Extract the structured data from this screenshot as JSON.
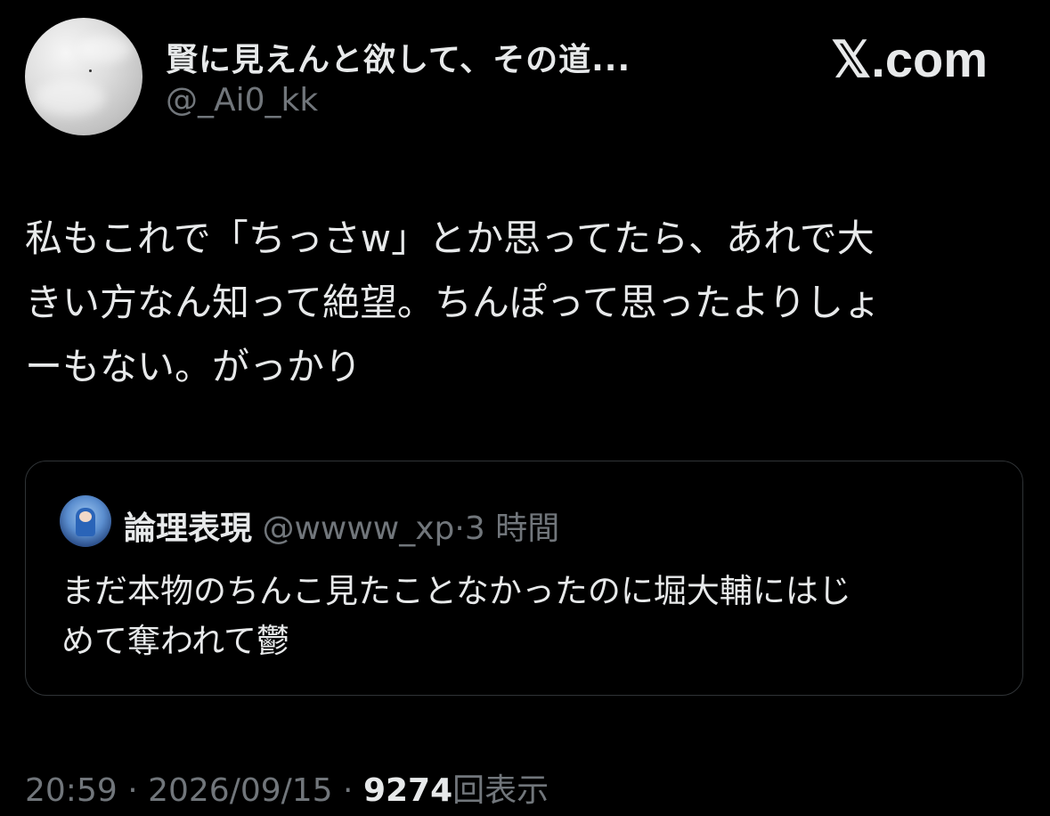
{
  "author": {
    "display_name": "賢に見えんと欲して、その道...",
    "handle": "@_Ai0_kk"
  },
  "brand": {
    "x_symbol": "𝕏",
    "domain_suffix": ".com"
  },
  "tweet": {
    "lines": [
      "私もこれで「ちっさw」とか思ってたら、あれで大",
      "きい方なん知って絶望。ちんぽって思ったよりしょ",
      "ーもない。がっかり"
    ]
  },
  "quote": {
    "name": "論理表現",
    "handle": "@wwww_xp",
    "separator": "·",
    "time": "3 時間",
    "lines": [
      "まだ本物のちんこ見たことなかったのに堀大輔にはじ",
      "めて奪われて鬱"
    ]
  },
  "footer": {
    "time": "20:59",
    "separator1": " · ",
    "date": "2026/09/15",
    "separator2": " · ",
    "views_count": "9274",
    "views_label": "回表示"
  },
  "colors": {
    "background": "#000000",
    "primary_text": "#e7e9ea",
    "secondary_text": "#71767b",
    "border": "#2f3336"
  }
}
